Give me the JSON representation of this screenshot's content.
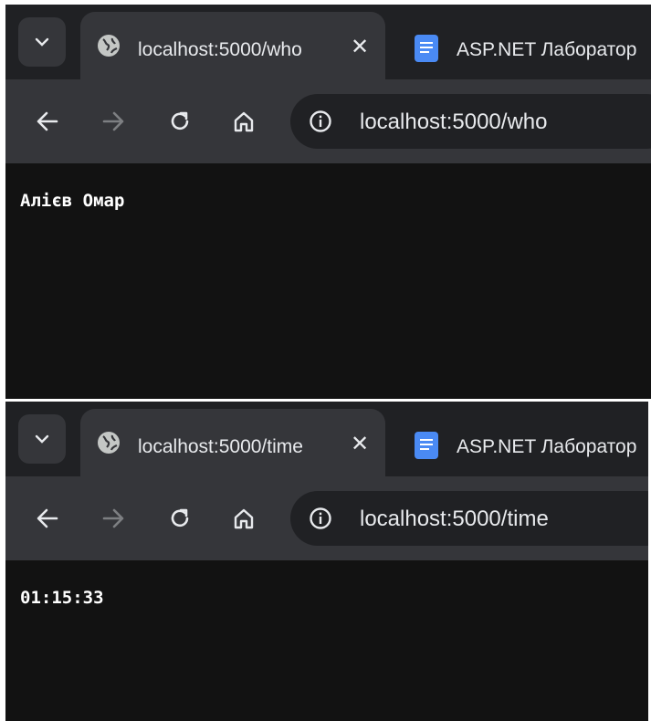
{
  "windows": [
    {
      "tabs": {
        "active": {
          "title": "localhost:5000/who",
          "icon": "globe-icon"
        },
        "inactive": {
          "title": "ASP.NET Лаборатор",
          "icon": "google-docs-icon"
        }
      },
      "address_bar": {
        "url": "localhost:5000/who"
      },
      "page_text": "Алієв Омар"
    },
    {
      "tabs": {
        "active": {
          "title": "localhost:5000/time",
          "icon": "globe-icon"
        },
        "inactive": {
          "title": "ASP.NET Лаборатор",
          "icon": "google-docs-icon"
        }
      },
      "address_bar": {
        "url": "localhost:5000/time"
      },
      "page_text": "01:15:33"
    }
  ],
  "colors": {
    "tabstrip": "#202124",
    "toolbar": "#35363a",
    "page_background": "#121212",
    "docs_blue": "#4a8af4",
    "text": "#e8eaed"
  }
}
